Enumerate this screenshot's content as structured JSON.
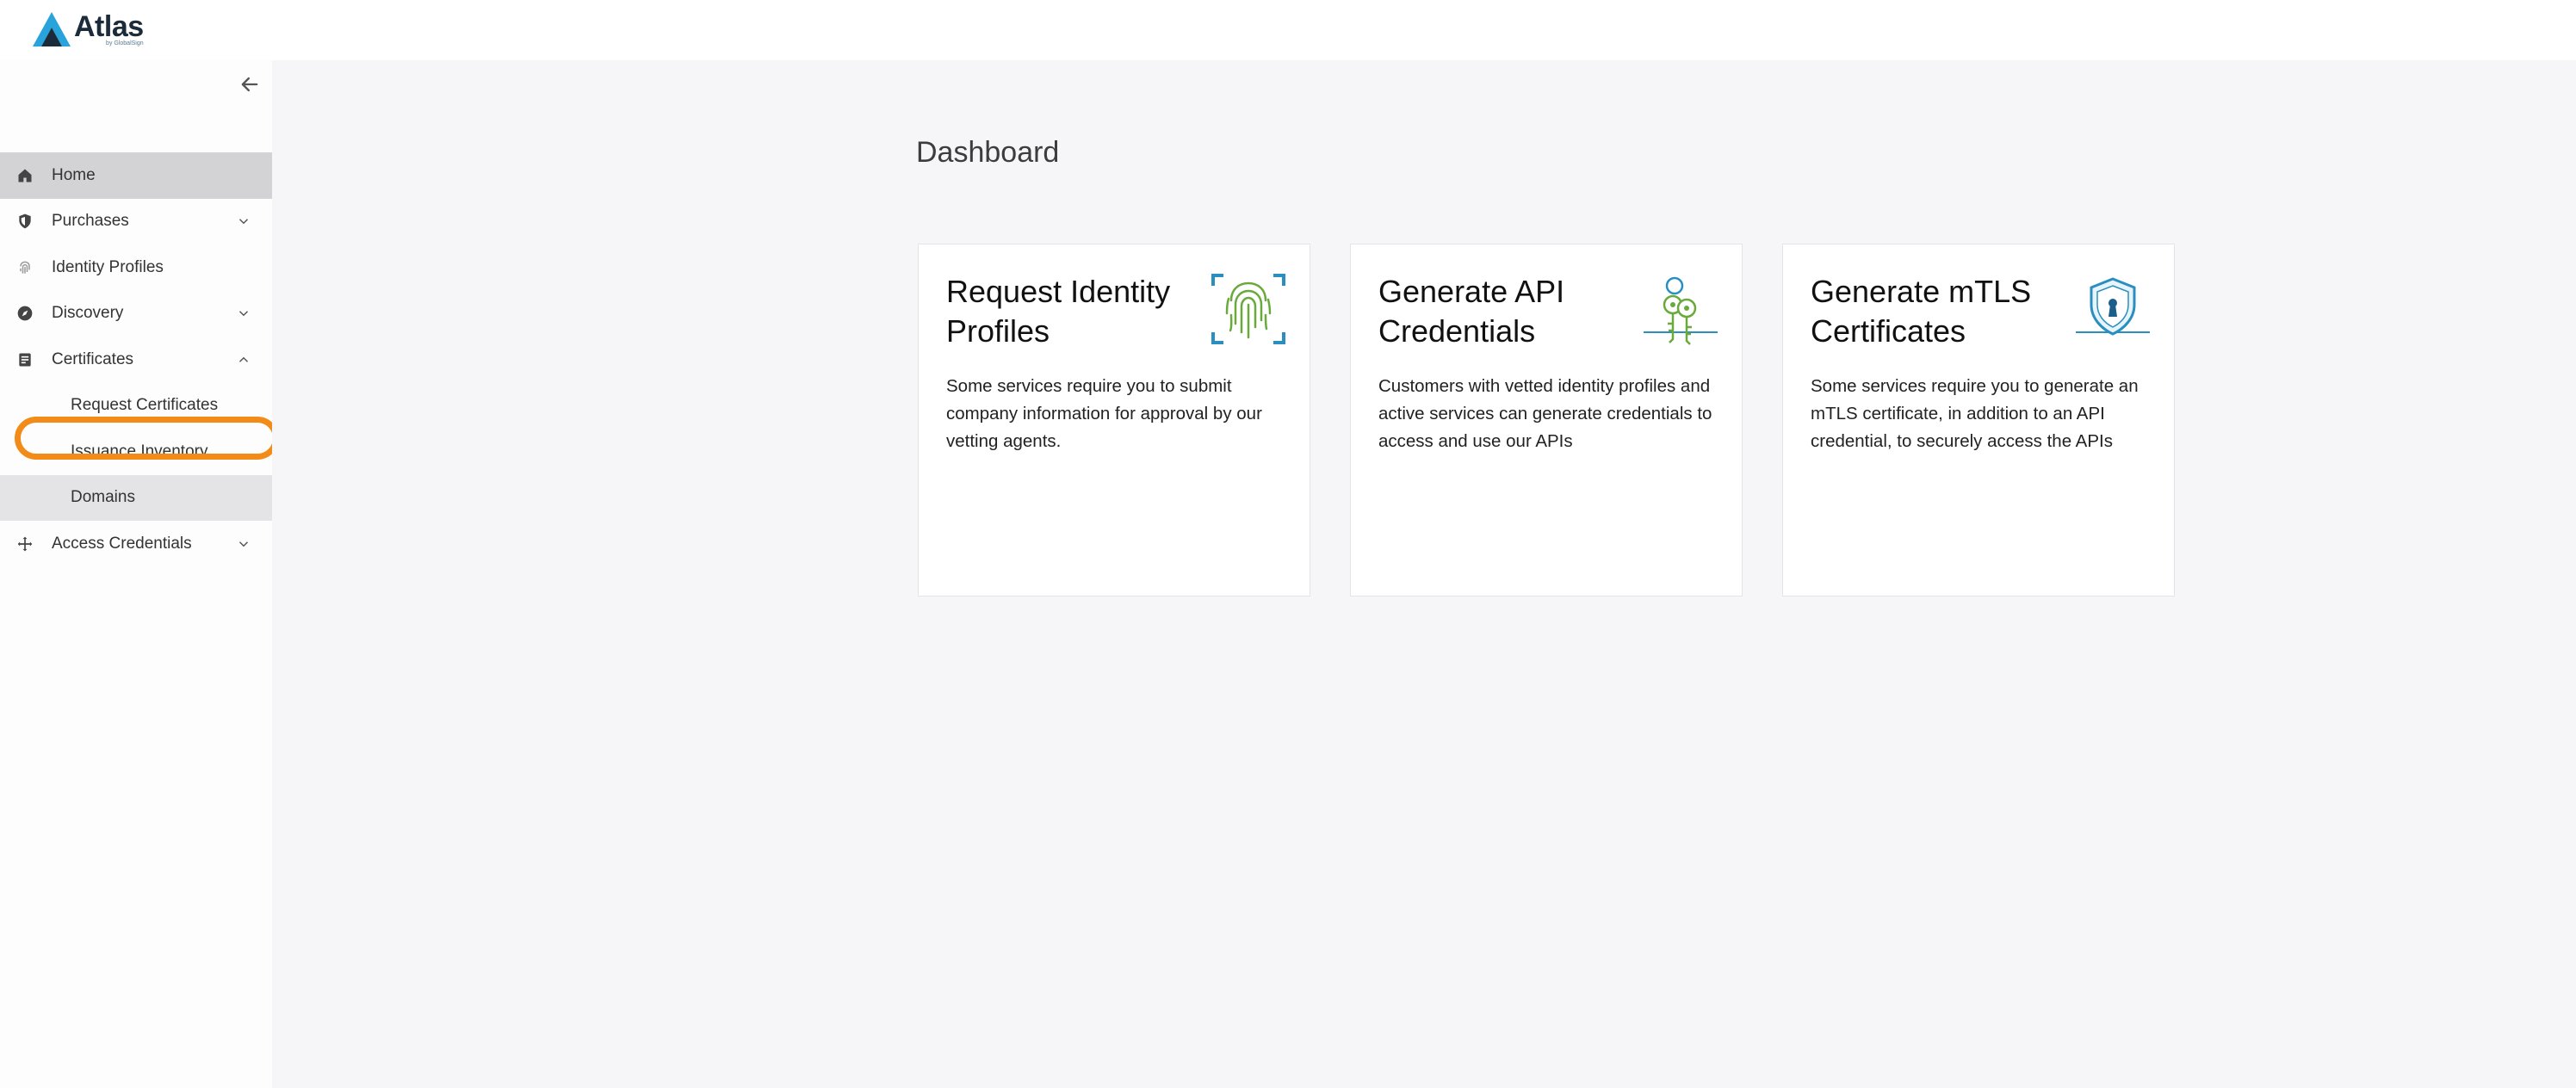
{
  "app": {
    "brand_name": "Atlas",
    "brand_sub": "by GlobalSign"
  },
  "colors": {
    "accent": "#29a3dc",
    "brand_dark": "#1b2b3a",
    "active_bg": "#d3d3d6",
    "highlight_ring": "#f28b17",
    "main_bg": "#f6f6f9"
  },
  "sidebar": {
    "collapse_icon": "arrow-left-icon",
    "items": [
      {
        "label": "Home",
        "icon": "home-icon",
        "active": true
      },
      {
        "label": "Purchases",
        "icon": "shield-icon",
        "chevron": "down"
      },
      {
        "label": "Identity Profiles",
        "icon": "fingerprint-icon"
      },
      {
        "label": "Discovery",
        "icon": "compass-icon",
        "chevron": "down"
      },
      {
        "label": "Certificates",
        "icon": "document-icon",
        "chevron": "up"
      },
      {
        "label": "Request Certificates",
        "sub": true
      },
      {
        "label": "Issuance Inventory",
        "sub": true
      },
      {
        "label": "Domains",
        "sub": true,
        "highlighted": true
      },
      {
        "label": "Access Credentials",
        "icon": "move-arrows-icon",
        "chevron": "down"
      }
    ]
  },
  "main": {
    "title": "Dashboard",
    "cards": [
      {
        "title": "Request Identity Profiles",
        "description": "Some services require you to submit company information for approval by our vetting agents.",
        "icon": "fingerprint-scan-icon"
      },
      {
        "title": "Generate API Credentials",
        "description": "Customers with vetted identity profiles and active services can generate credentials to access and use our APIs",
        "icon": "keys-icon"
      },
      {
        "title": "Generate mTLS Certificates",
        "description": "Some services require you to generate an mTLS certificate, in addition to an API credential, to securely access the APIs",
        "icon": "shield-lock-icon"
      }
    ]
  }
}
